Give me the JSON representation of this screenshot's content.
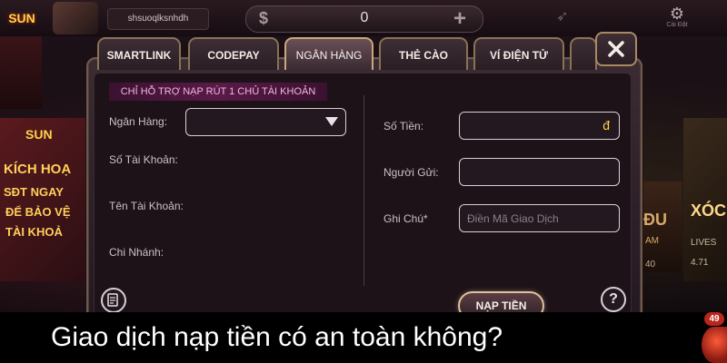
{
  "header": {
    "logo_text": "SUN",
    "username": "shsuoqlksnhdh",
    "balance": "0",
    "balance_currency_symbol": "$",
    "add_symbol": "+",
    "settings_label": "Cài Đặt"
  },
  "background": {
    "promo_logo": "SUN",
    "promo_lines": [
      "KÍCH HOẠ",
      "SĐT NGAY",
      "ĐỂ BẢO VỆ",
      "TÀI KHOẢ"
    ],
    "right_card_title": "XÓC",
    "right_card_sub": "LIVES",
    "right_card_count": "4.71",
    "mid_card_title": "ĐU",
    "mid_card_sub": "AM",
    "mid_card_count": "40"
  },
  "dialog": {
    "tabs": [
      {
        "label": "SMARTLINK",
        "active": false
      },
      {
        "label": "CODEPAY",
        "active": false
      },
      {
        "label": "NGÂN HÀNG",
        "active": true
      },
      {
        "label": "THẺ CÀO",
        "active": false
      },
      {
        "label": "VÍ ĐIỆN TỬ",
        "active": false
      }
    ],
    "close_symbol": "×",
    "notice": "CHỈ HỖ TRỢ NẠP RÚT 1 CHỦ TÀI KHOẢN",
    "left": {
      "bank_label": "Ngân Hàng:",
      "bank_value": "",
      "account_number_label": "Số Tài Khoản:",
      "account_name_label": "Tên Tài Khoản:",
      "branch_label": "Chi Nhánh:"
    },
    "right": {
      "amount_label": "Số Tiền:",
      "amount_value": "",
      "currency": "đ",
      "sender_label": "Người Gửi:",
      "sender_value": "",
      "note_label": "Ghi Chú*",
      "note_placeholder": "Điền Mã Giao Dịch",
      "submit_label": "NẠP TIỀN"
    },
    "help_symbol": "?"
  },
  "caption": {
    "text": "Giao dịch nạp tiền có an toàn không?",
    "notification_count": "49"
  }
}
